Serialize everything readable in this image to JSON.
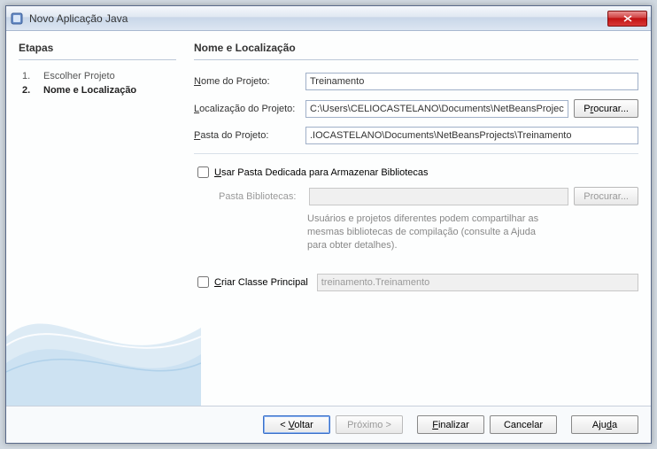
{
  "window": {
    "title": "Novo Aplicação Java"
  },
  "sidebar": {
    "title": "Etapas",
    "steps": [
      {
        "num": "1.",
        "label": "Escolher Projeto",
        "current": false
      },
      {
        "num": "2.",
        "label": "Nome e Localização",
        "current": true
      }
    ]
  },
  "main": {
    "title": "Nome e Localização",
    "project_name_label": "Nome do Projeto:",
    "project_name_value": "Treinamento",
    "project_location_label": "Localização do Projeto:",
    "project_location_value": "C:\\Users\\CELIOCASTELANO\\Documents\\NetBeansProjects",
    "browse1_label": "Procurar...",
    "project_folder_label": "Pasta do Projeto:",
    "project_folder_value": ".IOCASTELANO\\Documents\\NetBeansProjects\\Treinamento",
    "dedicated_folder_label": "Usar Pasta Dedicada para Armazenar Bibliotecas",
    "lib_folder_label": "Pasta Bibliotecas:",
    "lib_folder_value": "",
    "browse2_label": "Procurar...",
    "lib_help_text": "Usuários e projetos diferentes podem compartilhar as mesmas bibliotecas de compilação (consulte a Ajuda para obter detalhes).",
    "create_main_class_label": "Criar Classe Principal",
    "main_class_value": "treinamento.Treinamento"
  },
  "buttons": {
    "back": "< Voltar",
    "next": "Próximo >",
    "finish": "Finalizar",
    "cancel": "Cancelar",
    "help": "Ajuda"
  }
}
